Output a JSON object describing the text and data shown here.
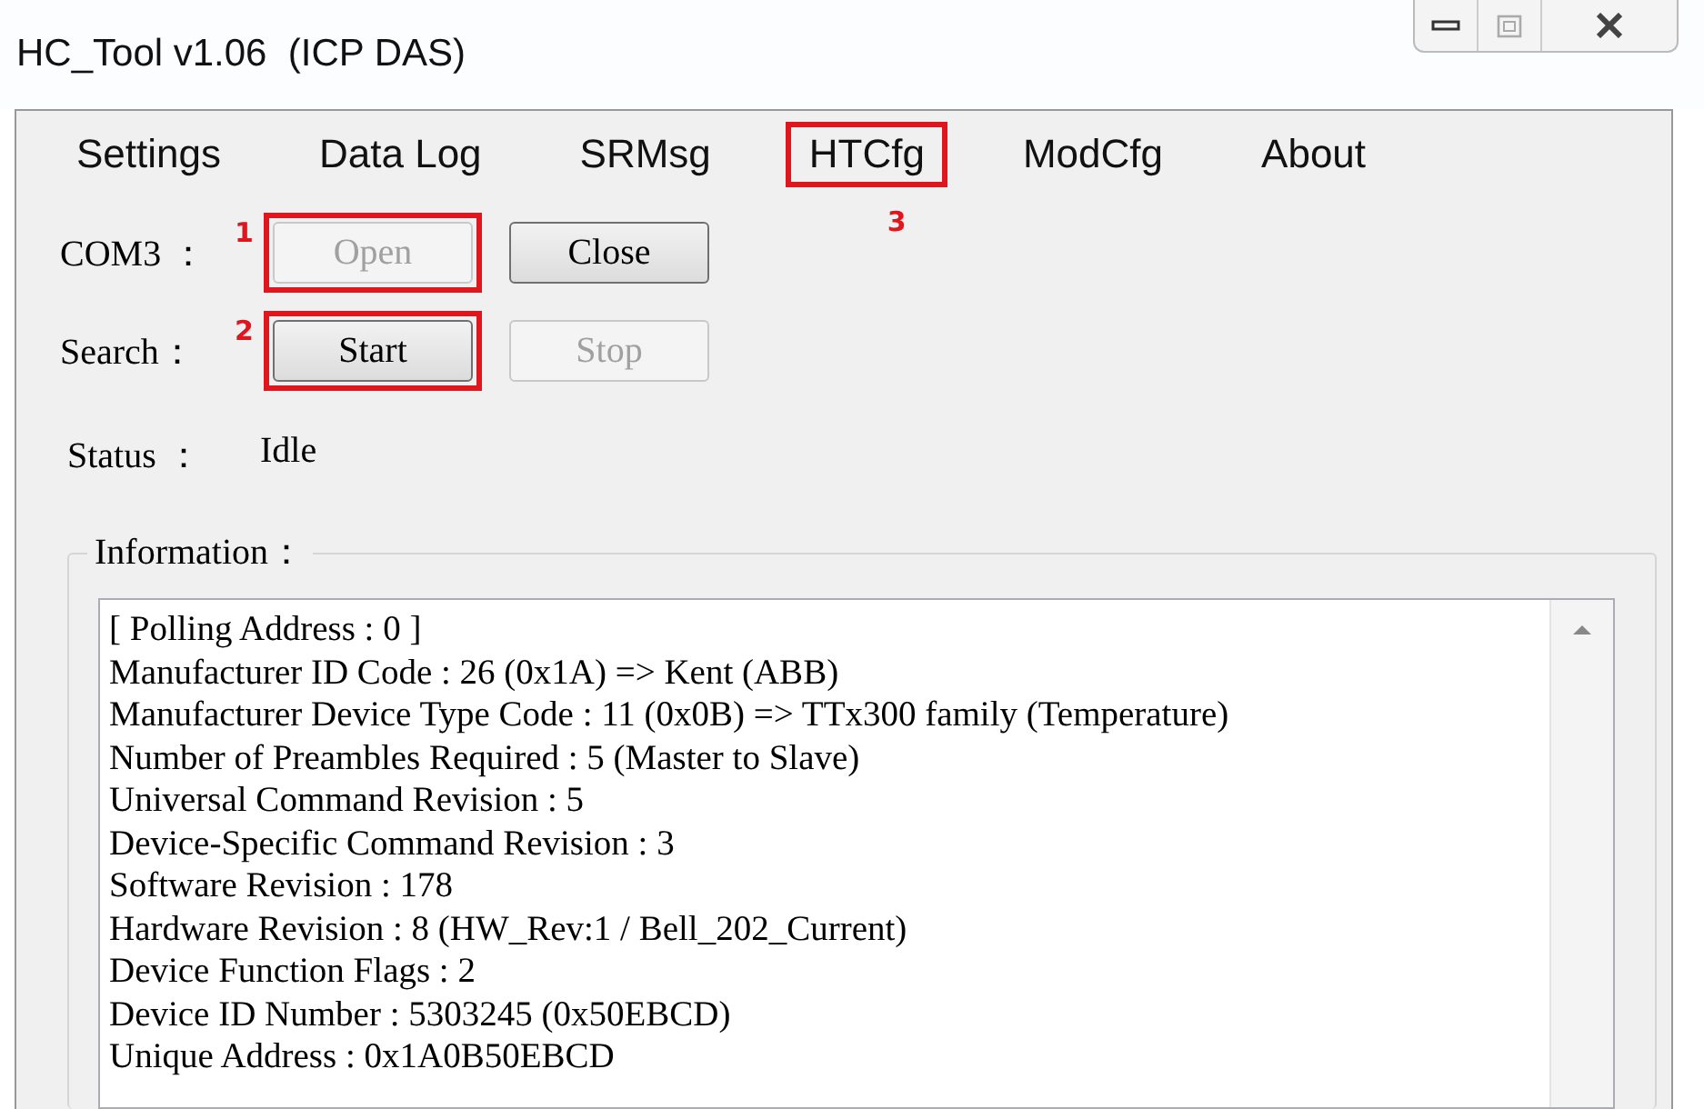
{
  "window": {
    "title": "HC_Tool v1.06  (ICP DAS)"
  },
  "menu": [
    {
      "label": "Settings",
      "highlighted": false
    },
    {
      "label": "Data Log",
      "highlighted": false
    },
    {
      "label": "SRMsg",
      "highlighted": false
    },
    {
      "label": "HTCfg",
      "highlighted": true,
      "callout": "3"
    },
    {
      "label": "ModCfg",
      "highlighted": false
    },
    {
      "label": "About",
      "highlighted": false
    }
  ],
  "rows": [
    {
      "label": "COM3 ：",
      "callout": "1",
      "buttons": [
        {
          "label": "Open",
          "disabled": true,
          "highlighted": true
        },
        {
          "label": "Close",
          "disabled": false,
          "highlighted": false
        }
      ]
    },
    {
      "label": "Search：",
      "callout": "2",
      "buttons": [
        {
          "label": "Start",
          "disabled": false,
          "highlighted": true
        },
        {
          "label": "Stop",
          "disabled": true,
          "highlighted": false
        }
      ]
    }
  ],
  "status": {
    "label": "Status ：",
    "value": "Idle"
  },
  "information": {
    "label": "Information：",
    "lines": [
      "[ Polling Address : 0 ]",
      "Manufacturer ID Code : 26 (0x1A) => Kent (ABB)",
      "Manufacturer Device Type Code : 11 (0x0B) => TTx300 family (Temperature)",
      "Number of Preambles Required : 5 (Master to Slave)",
      "Universal Command Revision : 5",
      "Device-Specific Command Revision : 3",
      "Software Revision : 178",
      "Hardware Revision : 8 (HW_Rev:1 / Bell_202_Current)",
      "Device Function Flags : 2",
      "Device ID Number : 5303245 (0x50EBCD)",
      "Unique Address : 0x1A0B50EBCD"
    ]
  }
}
